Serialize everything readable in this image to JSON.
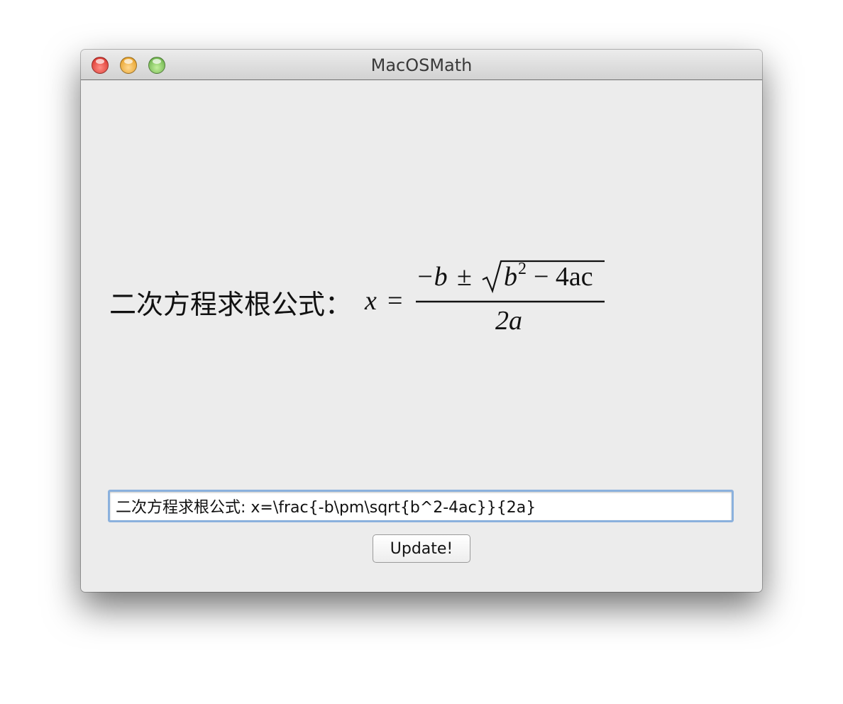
{
  "window": {
    "title": "MacOSMath"
  },
  "formula": {
    "prefix": "二次方程求根公式：",
    "lhs": "x",
    "equals": "=",
    "numerator_neg_b": "−b",
    "plus_minus": "±",
    "radicand_base": "b",
    "radicand_exponent": "2",
    "radicand_rest": "− 4ac",
    "denominator": "2a"
  },
  "input": {
    "value": "二次方程求根公式: x=\\frac{-b\\pm\\sqrt{b^2-4ac}}{2a}"
  },
  "update_button": {
    "label": "Update!"
  },
  "colors": {
    "window_bg": "#ececec",
    "focus_ring": "#8bb1dd",
    "close": "#d2231d",
    "minimize": "#e0930f",
    "maximize": "#5aa63a"
  }
}
